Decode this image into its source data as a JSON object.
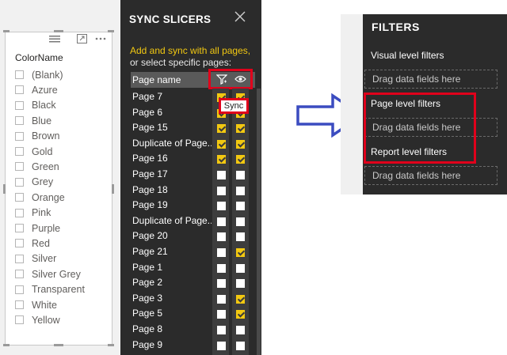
{
  "slicer": {
    "title": "ColorName",
    "items": [
      "(Blank)",
      "Azure",
      "Black",
      "Blue",
      "Brown",
      "Gold",
      "Green",
      "Grey",
      "Orange",
      "Pink",
      "Purple",
      "Red",
      "Silver",
      "Silver Grey",
      "Transparent",
      "White",
      "Yellow"
    ]
  },
  "sync_pane": {
    "title": "SYNC SLICERS",
    "close_icon": "close-icon",
    "help_line1": "Add and sync with all pages,",
    "help_line2": "or select specific pages:",
    "header_label": "Page name",
    "tooltip": "Sync",
    "pages": [
      {
        "name": "Page 7",
        "sync": true,
        "visible": true
      },
      {
        "name": "Page 6",
        "sync": true,
        "visible": true
      },
      {
        "name": "Page 15",
        "sync": true,
        "visible": true
      },
      {
        "name": "Duplicate of Page...",
        "sync": true,
        "visible": true
      },
      {
        "name": "Page 16",
        "sync": true,
        "visible": true
      },
      {
        "name": "Page 17",
        "sync": false,
        "visible": false
      },
      {
        "name": "Page 18",
        "sync": false,
        "visible": false
      },
      {
        "name": "Page 19",
        "sync": false,
        "visible": false
      },
      {
        "name": "Duplicate of Page...",
        "sync": false,
        "visible": false
      },
      {
        "name": "Page 20",
        "sync": false,
        "visible": false
      },
      {
        "name": "Page 21",
        "sync": false,
        "visible": true
      },
      {
        "name": "Page 1",
        "sync": false,
        "visible": false
      },
      {
        "name": "Page 2",
        "sync": false,
        "visible": false
      },
      {
        "name": "Page 3",
        "sync": false,
        "visible": true
      },
      {
        "name": "Page 5",
        "sync": false,
        "visible": true
      },
      {
        "name": "Page 8",
        "sync": false,
        "visible": false
      },
      {
        "name": "Page 9",
        "sync": false,
        "visible": false
      }
    ]
  },
  "filters_pane": {
    "title": "FILTERS",
    "visual_level": "Visual level filters",
    "page_level": "Page level filters",
    "report_level": "Report level filters",
    "drop_text": "Drag data fields here"
  },
  "colors": {
    "accent_yellow": "#f2c811",
    "highlight_red": "#e0001b",
    "arrow_blue": "#3b4cc0",
    "pane_dark": "#2b2b2b"
  }
}
